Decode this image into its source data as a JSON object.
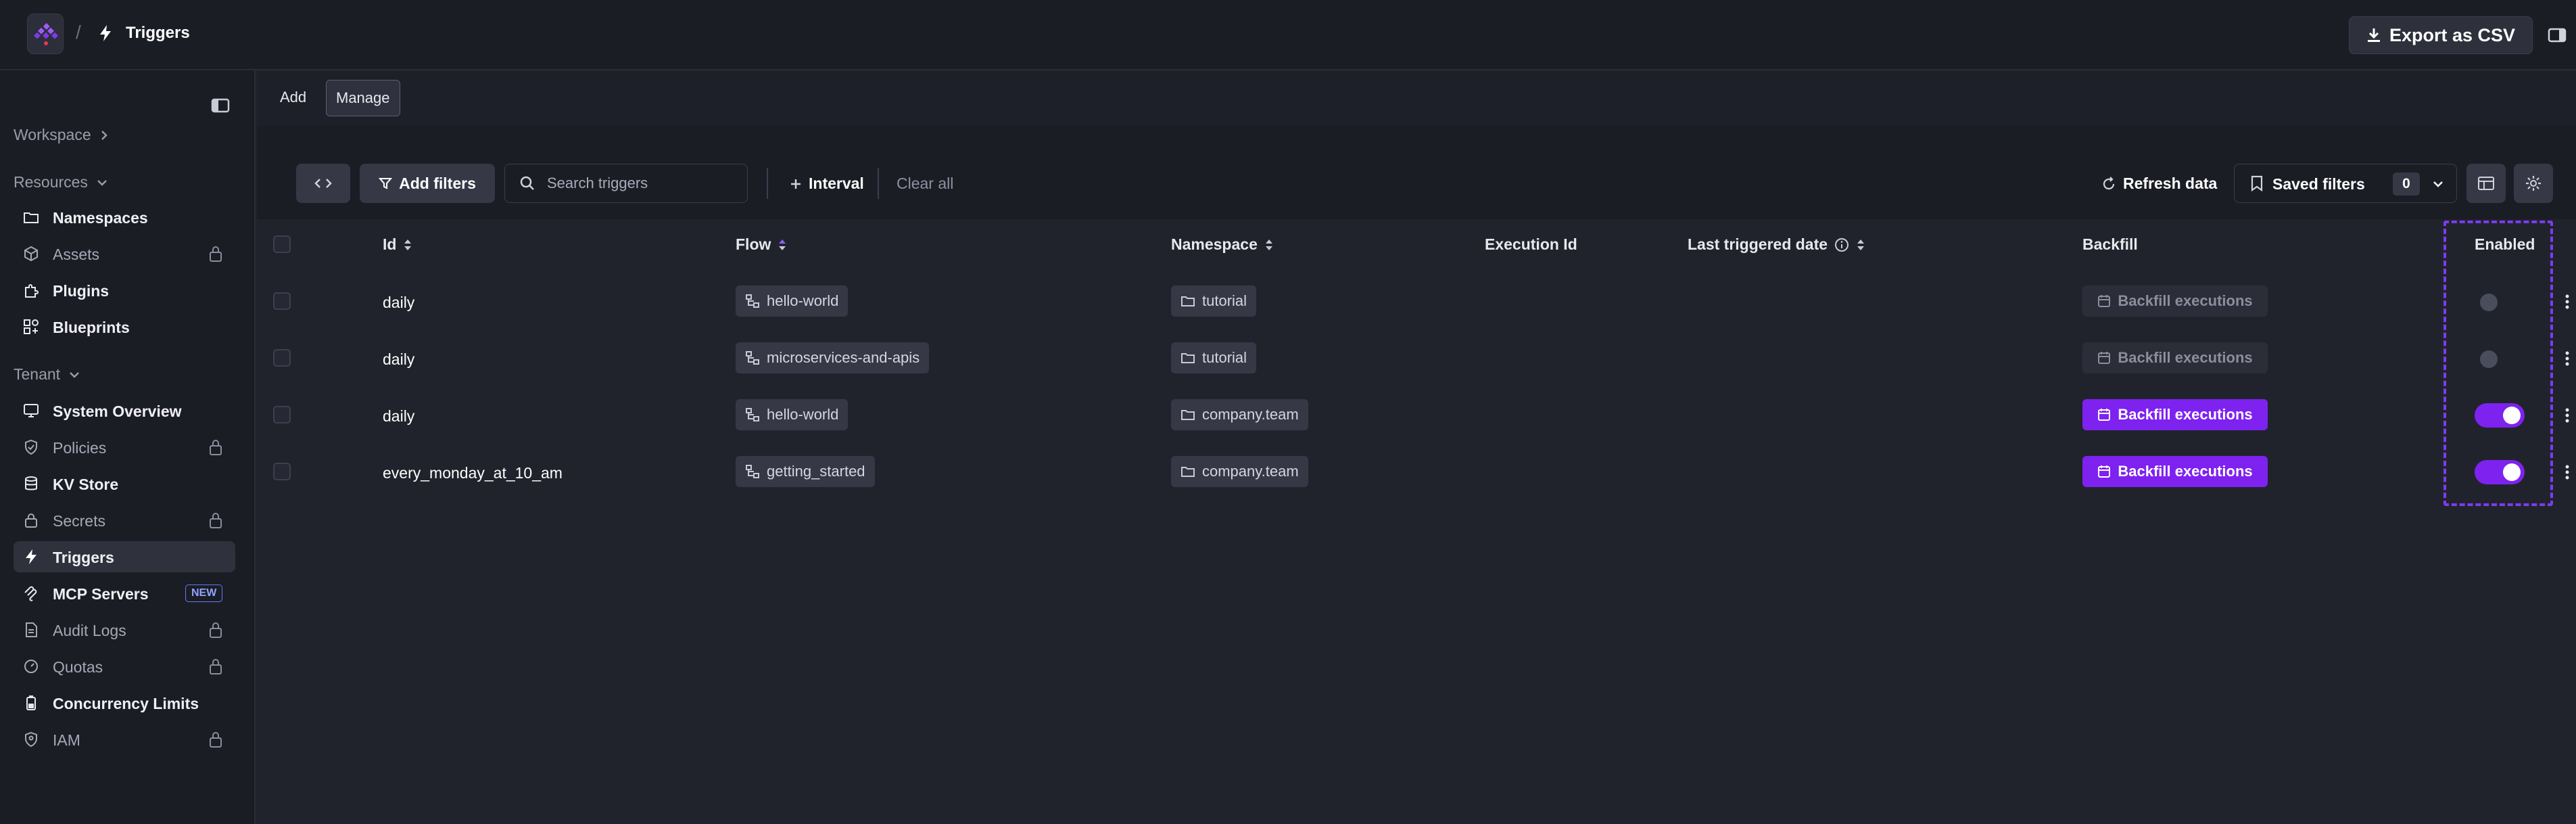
{
  "header": {
    "separator": "/",
    "page_title": "Triggers",
    "export_label": "Export as CSV"
  },
  "sidebar": {
    "workspace_label": "Workspace",
    "resources_label": "Resources",
    "tenant_label": "Tenant",
    "items": [
      {
        "label": "Namespaces",
        "icon": "folder-icon",
        "locked": false
      },
      {
        "label": "Assets",
        "icon": "cube-icon",
        "locked": true
      },
      {
        "label": "Plugins",
        "icon": "puzzle-icon",
        "locked": false
      },
      {
        "label": "Blueprints",
        "icon": "blueprint-icon",
        "locked": false
      },
      {
        "label": "System Overview",
        "icon": "monitor-icon",
        "locked": false
      },
      {
        "label": "Policies",
        "icon": "shield-icon",
        "locked": true
      },
      {
        "label": "KV Store",
        "icon": "database-icon",
        "locked": false
      },
      {
        "label": "Secrets",
        "icon": "lock-icon",
        "locked": true
      },
      {
        "label": "Triggers",
        "icon": "bolt-icon",
        "locked": false,
        "active": true
      },
      {
        "label": "MCP Servers",
        "icon": "mcp-icon",
        "locked": false,
        "badge": "NEW"
      },
      {
        "label": "Audit Logs",
        "icon": "document-icon",
        "locked": true
      },
      {
        "label": "Quotas",
        "icon": "gauge-icon",
        "locked": true
      },
      {
        "label": "Concurrency Limits",
        "icon": "battery-icon",
        "locked": false
      },
      {
        "label": "IAM",
        "icon": "user-shield-icon",
        "locked": true
      }
    ]
  },
  "tabs": [
    {
      "label": "Add",
      "active": false
    },
    {
      "label": "Manage",
      "active": true
    }
  ],
  "toolbar": {
    "add_filters": "Add filters",
    "search_placeholder": "Search triggers",
    "interval": "Interval",
    "clear_all": "Clear all",
    "refresh": "Refresh data",
    "saved_filters": "Saved filters",
    "saved_count": "0"
  },
  "table": {
    "columns": [
      "Id",
      "Flow",
      "Namespace",
      "Execution Id",
      "Last triggered date",
      "Backfill",
      "Enabled"
    ],
    "rows": [
      {
        "id": "daily",
        "flow": "hello-world",
        "namespace": "tutorial",
        "execution_id": "",
        "last_triggered": "",
        "backfill": "Backfill executions",
        "backfill_enabled": false,
        "enabled": false
      },
      {
        "id": "daily",
        "flow": "microservices-and-apis",
        "namespace": "tutorial",
        "execution_id": "",
        "last_triggered": "",
        "backfill": "Backfill executions",
        "backfill_enabled": false,
        "enabled": false
      },
      {
        "id": "daily",
        "flow": "hello-world",
        "namespace": "company.team",
        "execution_id": "",
        "last_triggered": "",
        "backfill": "Backfill executions",
        "backfill_enabled": true,
        "enabled": true
      },
      {
        "id": "every_monday_at_10_am",
        "flow": "getting_started",
        "namespace": "company.team",
        "execution_id": "",
        "last_triggered": "",
        "backfill": "Backfill executions",
        "backfill_enabled": true,
        "enabled": true
      }
    ]
  },
  "colors": {
    "accent": "#7e22f0",
    "background": "#21232c",
    "sidebar": "#1b1d25"
  }
}
